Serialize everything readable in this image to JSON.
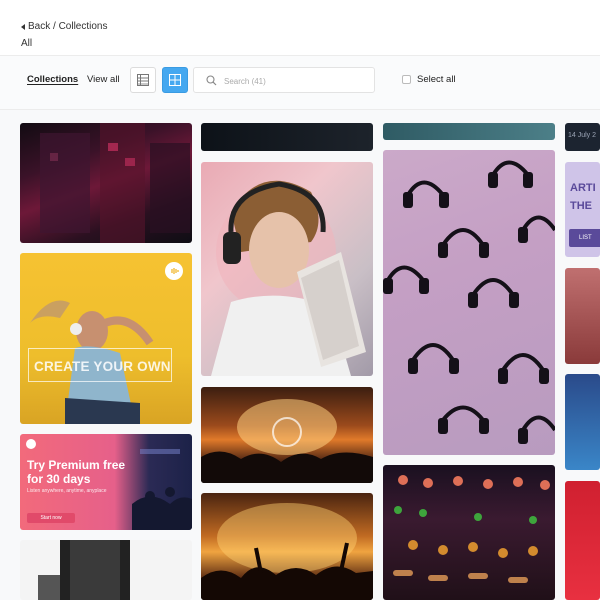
{
  "header": {
    "back_label": "Back / Collections",
    "title": "All"
  },
  "toolbar": {
    "tab_collections": "Collections",
    "tab_view_all": "View all",
    "search_placeholder": "Search (41)",
    "select_all_label": "Select all",
    "accent_color": "#45a8f0"
  },
  "tiles": {
    "create_text": "CREATE YOUR OWN",
    "premium_title": "Try Premium free for 30 days",
    "premium_sub": "Listen anywhere, anytime, anyplace",
    "premium_cta": "Start now",
    "date_text": "14 July 2",
    "artist_text": "ARTI THE",
    "artist_cta": "LIST"
  }
}
